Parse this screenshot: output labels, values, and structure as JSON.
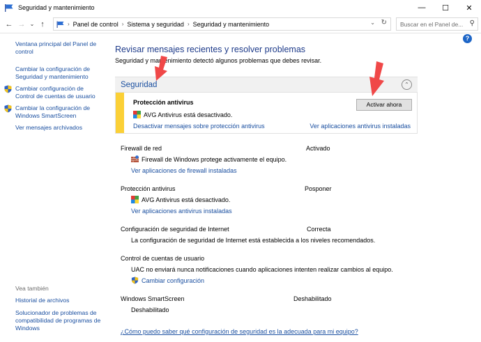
{
  "window": {
    "title": "Seguridad y mantenimiento",
    "minimize": "—",
    "maximize": "☐",
    "close": "✕"
  },
  "nav": {
    "back": "←",
    "forward": "→",
    "history": "⌄",
    "up": "↑"
  },
  "address": {
    "crumbs": [
      "Panel de control",
      "Sistema y seguridad",
      "Seguridad y mantenimiento"
    ],
    "separator": "›",
    "dropdown": "⌄",
    "refresh": "↻"
  },
  "search": {
    "placeholder": "Buscar en el Panel de..."
  },
  "help": "?",
  "sidebar": {
    "items": [
      "Ventana principal del Panel de control",
      "Cambiar la configuración de Seguridad y mantenimiento",
      "Cambiar configuración de Control de cuentas de usuario",
      "Cambiar la configuración de Windows SmartScreen",
      "Ver mensajes archivados"
    ],
    "see_also_header": "Vea también",
    "see_also": [
      "Historial de archivos",
      "Solucionador de problemas de compatibilidad de programas de Windows"
    ]
  },
  "main": {
    "title": "Revisar mensajes recientes y resolver problemas",
    "subtitle": "Seguridad y mantenimiento detectó algunos problemas que debes revisar.",
    "section_title": "Seguridad",
    "collapse": "⌃",
    "alert": {
      "title": "Protección antivirus",
      "text": "AVG Antivirus está desactivado.",
      "button": "Activar ahora",
      "link_left": "Desactivar mensajes sobre protección antivirus",
      "link_right": "Ver aplicaciones antivirus instaladas"
    },
    "rows": {
      "firewall": {
        "label": "Firewall de red",
        "status": "Activado",
        "detail": "Firewall de Windows protege activamente el equipo.",
        "link": "Ver aplicaciones de firewall instaladas"
      },
      "antivirus": {
        "label": "Protección antivirus",
        "status": "Posponer",
        "detail": "AVG Antivirus está desactivado.",
        "link": "Ver aplicaciones antivirus instaladas"
      },
      "internet": {
        "label": "Configuración de seguridad de Internet",
        "status": "Correcta",
        "detail": "La configuración de seguridad de Internet está establecida a los niveles recomendados."
      },
      "uac": {
        "label": "Control de cuentas de usuario",
        "detail": "UAC no enviará nunca notificaciones cuando aplicaciones intenten realizar cambios al equipo.",
        "link": "Cambiar configuración"
      },
      "smartscreen": {
        "label": "Windows SmartScreen",
        "status": "Deshabilitado",
        "detail": "Deshabilitado"
      }
    },
    "bottom_link": "¿Cómo puedo saber qué configuración de seguridad es la adecuada para mi equipo?"
  },
  "colors": {
    "link": "#1a4fa0",
    "title": "#1e3b8a",
    "alert_bar": "#fbd036",
    "arrow": "#f04848"
  }
}
